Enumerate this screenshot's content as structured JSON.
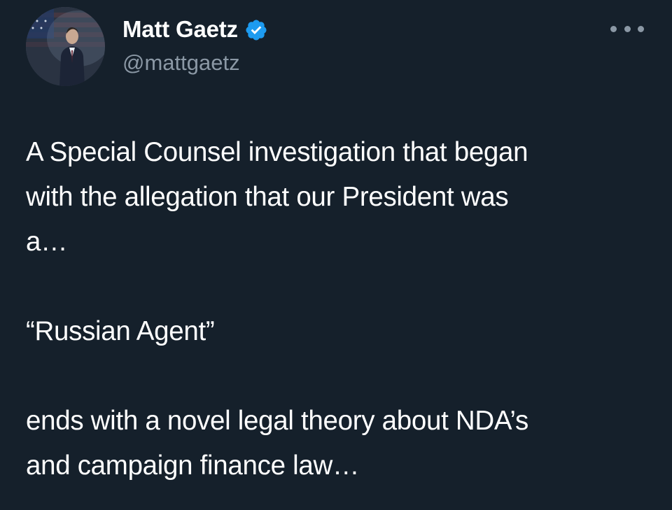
{
  "author": {
    "name": "Matt Gaetz",
    "handle": "@mattgaetz",
    "verified": true,
    "verified_icon": "verified-badge-icon",
    "avatar": "profile-photo"
  },
  "tweet": {
    "paragraphs": [
      [
        "A Special Counsel investigation that began",
        "with the allegation that our President was",
        "a…"
      ],
      [
        "“Russian Agent”"
      ],
      [
        "ends with a novel legal theory about NDA’s",
        "and campaign finance law…"
      ]
    ]
  },
  "more_menu": {
    "icon": "more-dots-icon"
  },
  "colors": {
    "background": "#15202b",
    "text": "#ffffff",
    "secondary_text": "#8b98a5",
    "verified_blue": "#1d9bf0"
  }
}
